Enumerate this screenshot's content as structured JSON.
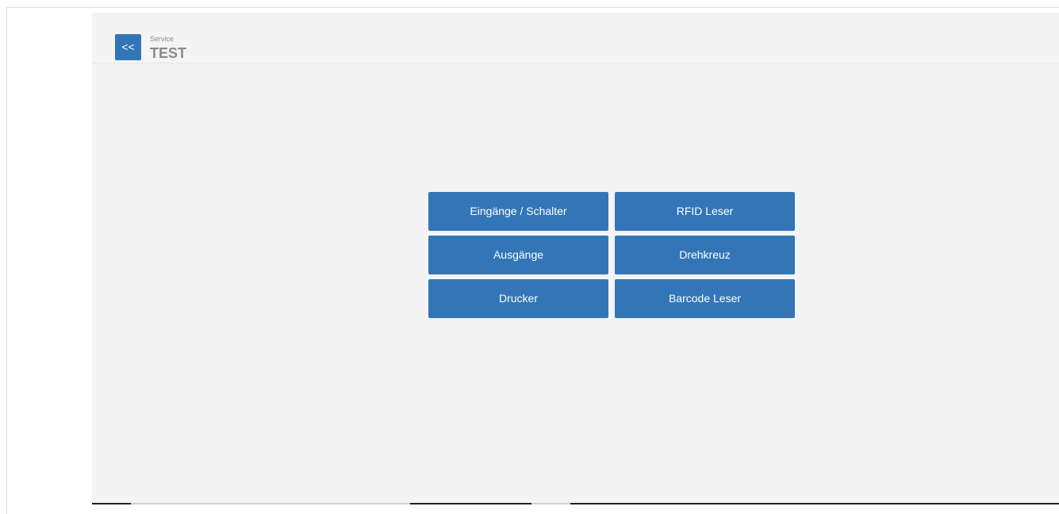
{
  "header": {
    "back_label": "<<",
    "breadcrumb": "Service",
    "title": "TEST"
  },
  "menu": {
    "items": [
      {
        "label": "Eingänge / Schalter"
      },
      {
        "label": "RFID Leser"
      },
      {
        "label": "Ausgänge"
      },
      {
        "label": "Drehkreuz"
      },
      {
        "label": "Drucker"
      },
      {
        "label": "Barcode Leser"
      }
    ]
  },
  "colors": {
    "accent": "#3276b8",
    "panel_bg": "#f4f4f4",
    "muted_text": "#8a8a8a"
  }
}
